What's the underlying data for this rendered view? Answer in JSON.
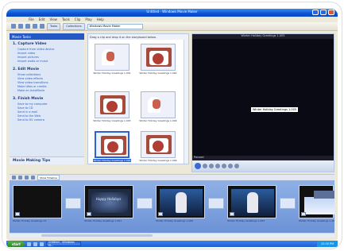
{
  "window": {
    "title": "Untitled - Windows Movie Maker",
    "menu": [
      "File",
      "Edit",
      "View",
      "Tools",
      "Clip",
      "Play",
      "Help"
    ]
  },
  "toolbar": {
    "tasks_label": "Tasks",
    "collections_label": "Collections",
    "collection_combo": "Windows Movie Maker"
  },
  "tasks_pane": {
    "header": "Movie Tasks",
    "sections": [
      {
        "title": "1. Capture Video",
        "items": [
          "Capture from video device",
          "Import video",
          "Import pictures",
          "Import audio or music"
        ]
      },
      {
        "title": "2. Edit Movie",
        "items": [
          "Show collections",
          "View video effects",
          "View video transitions",
          "Make titles or credits",
          "Make an AutoMovie"
        ]
      },
      {
        "title": "3. Finish Movie",
        "items": [
          "Save to my computer",
          "Save to CD",
          "Send in e-mail",
          "Send to the Web",
          "Send to DV camera"
        ]
      }
    ],
    "tips": "Movie Making Tips"
  },
  "collection": {
    "header": "Drag a clip and drop it on the storyboard below.",
    "clips": [
      {
        "label": "Winter Holiday Greetings 1.001"
      },
      {
        "label": "Winter Holiday Greetings 1.002"
      },
      {
        "label": "Winter Holiday Greetings 1.003"
      },
      {
        "label": "Winter Holiday Greetings 1.004"
      },
      {
        "label": "Winter Holiday Greetings 1.005"
      },
      {
        "label": "Winter Holiday Greetings 1.006"
      }
    ]
  },
  "monitor": {
    "title": "Winter Holiday Greetings 1.005",
    "overlay": "Winter Holiday Greetings 1.005",
    "status": "Paused"
  },
  "storyboard": {
    "show_timeline": "Show Timeline",
    "cells": [
      {
        "label": "Winter Holiday Greetings 01"
      },
      {
        "label": "Winter Holiday Greetings 1.001"
      },
      {
        "label": "Winter Holiday Greetings 1.002"
      },
      {
        "label": "Winter Holiday Greetings 1.003"
      },
      {
        "label": "Winter Holiday Greetings 1.004"
      }
    ]
  },
  "taskbar": {
    "start": "start",
    "task": "Untitled - Windows M...",
    "clock": "12:00 PM"
  }
}
